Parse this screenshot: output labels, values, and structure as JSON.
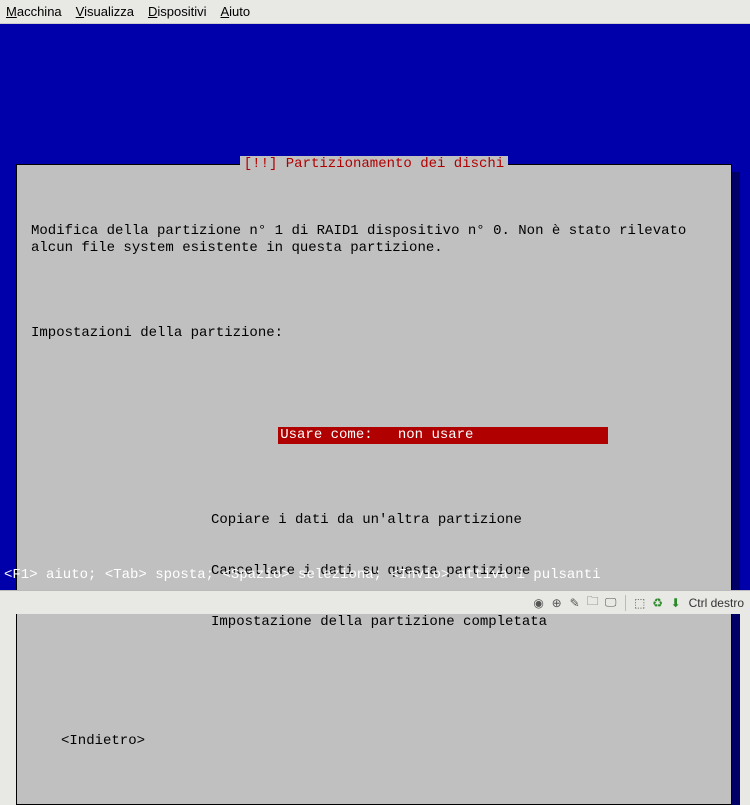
{
  "menubar": {
    "items": [
      {
        "accel": "M",
        "rest": "acchina"
      },
      {
        "accel": "V",
        "rest": "isualizza"
      },
      {
        "accel": "D",
        "rest": "ispositivi"
      },
      {
        "accel": "A",
        "rest": "iuto"
      }
    ]
  },
  "dialog": {
    "title": "[!!] Partizionamento dei dischi",
    "body_line1": "Modifica della partizione n° 1 di RAID1 dispositivo n° 0. Non è stato rilevato alcun file system esistente in questa partizione.",
    "settings_label": "Impostazioni della partizione:",
    "option_selected": "Usare come:   non usare",
    "option_copy": "Copiare i dati da un'altra partizione",
    "option_erase": "Cancellare i dati su questa partizione",
    "option_done": "Impostazione della partizione completata",
    "back_label": "<Indietro>"
  },
  "help_line": "<F1> aiuto; <Tab> sposta; <Spazio> seleziona; <Invio> attiva i pulsanti",
  "statusbar": {
    "host_key": "Ctrl destro"
  }
}
